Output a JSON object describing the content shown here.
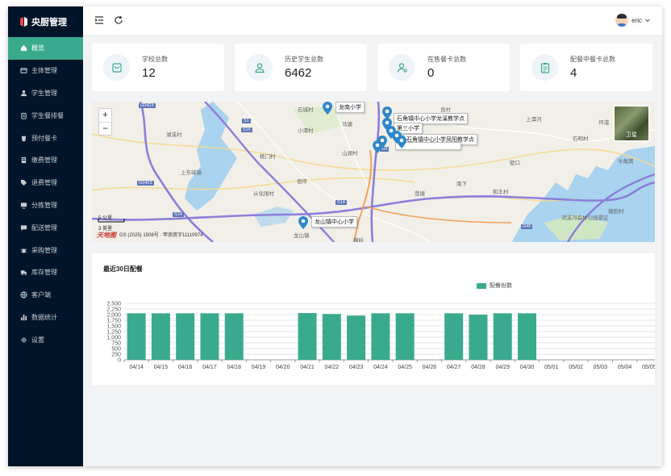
{
  "app": {
    "title": "央厨管理"
  },
  "sidebar": {
    "items": [
      {
        "label": "概览",
        "icon": "home-icon",
        "active": true
      },
      {
        "label": "主体管理",
        "icon": "card-icon"
      },
      {
        "label": "学生管理",
        "icon": "user-icon"
      },
      {
        "label": "学生餐排餐",
        "icon": "clipboard-icon"
      },
      {
        "label": "预付餐卡",
        "icon": "cup-icon"
      },
      {
        "label": "缴费管理",
        "icon": "ledger-icon"
      },
      {
        "label": "退费管理",
        "icon": "tag-icon"
      },
      {
        "label": "分拣管理",
        "icon": "monitor-icon"
      },
      {
        "label": "配送管理",
        "icon": "chat-icon"
      },
      {
        "label": "采购管理",
        "icon": "bug-icon"
      },
      {
        "label": "库存管理",
        "icon": "truck-icon"
      },
      {
        "label": "客户端",
        "icon": "globe-icon"
      },
      {
        "label": "数据统计",
        "icon": "bar-chart-icon"
      },
      {
        "label": "设置",
        "icon": "gear-icon"
      }
    ]
  },
  "topbar": {
    "username": "eric"
  },
  "stats": [
    {
      "label": "学校总数",
      "value": "12",
      "icon": "shopping-bag-icon"
    },
    {
      "label": "历史学生总数",
      "value": "6462",
      "icon": "user-outline-icon"
    },
    {
      "label": "在售餐卡总数",
      "value": "0",
      "icon": "user-settings-icon"
    },
    {
      "label": "配餐中餐卡总数",
      "value": "4",
      "icon": "checklist-icon"
    }
  ],
  "map": {
    "zoom_in": "+",
    "zoom_out": "−",
    "satellite_label": "卫星",
    "scale_km": "5 公里",
    "scale_mi": "3 英里",
    "brand": "天地图",
    "copyright": "GS (2025) 1508号 · 甲测资字11110974",
    "pins": [
      {
        "label": "龙南小学"
      },
      {
        "label": "石角镇中心小学龙溪教学点"
      },
      {
        "label": "第三小学"
      },
      {
        "label": "石角镇中心小学凤阳教学点"
      },
      {
        "label": "龙山镇中心小学"
      }
    ],
    "places": [
      "石城村",
      "小潭村",
      "马塘",
      "良村",
      "上潭河",
      "坪浦",
      "湖溪村",
      "石明村",
      "桃门村",
      "山湖村",
      "牛角窝",
      "上东峡镇",
      "佰坪",
      "壁口",
      "从化围村",
      "莲塘",
      "南下",
      "和丰村",
      "塘田村",
      "龙山镇",
      "横岭",
      "流溪河森林公园景区"
    ],
    "roads": [
      "G0423",
      "S1",
      "S16",
      "G0423",
      "S14",
      "S14",
      "G4",
      "G45"
    ]
  },
  "chart_card": {
    "title": "最近30日配餐"
  },
  "chart_data": {
    "type": "bar",
    "categories": [
      "04/14",
      "04/15",
      "04/16",
      "04/17",
      "04/18",
      "04/19",
      "04/20",
      "04/21",
      "04/22",
      "04/23",
      "04/24",
      "04/25",
      "04/26",
      "04/27",
      "04/28",
      "04/29",
      "04/30",
      "05/01",
      "05/02",
      "05/03",
      "05/04",
      "05/05"
    ],
    "series": [
      {
        "name": "配餐份数",
        "values": [
          2060,
          2060,
          2060,
          2060,
          2060,
          0,
          0,
          2070,
          2030,
          1960,
          2060,
          2060,
          0,
          2060,
          2000,
          2060,
          2060,
          0,
          0,
          0,
          0,
          0
        ]
      }
    ],
    "yticks": [
      "0",
      "250",
      "500",
      "750",
      "1,000",
      "1,250",
      "1,500",
      "1,750",
      "2,000",
      "2,250",
      "2,500"
    ],
    "ylim": [
      0,
      2500
    ],
    "color": "#3aaa8e",
    "grid": true,
    "legend": "top"
  }
}
